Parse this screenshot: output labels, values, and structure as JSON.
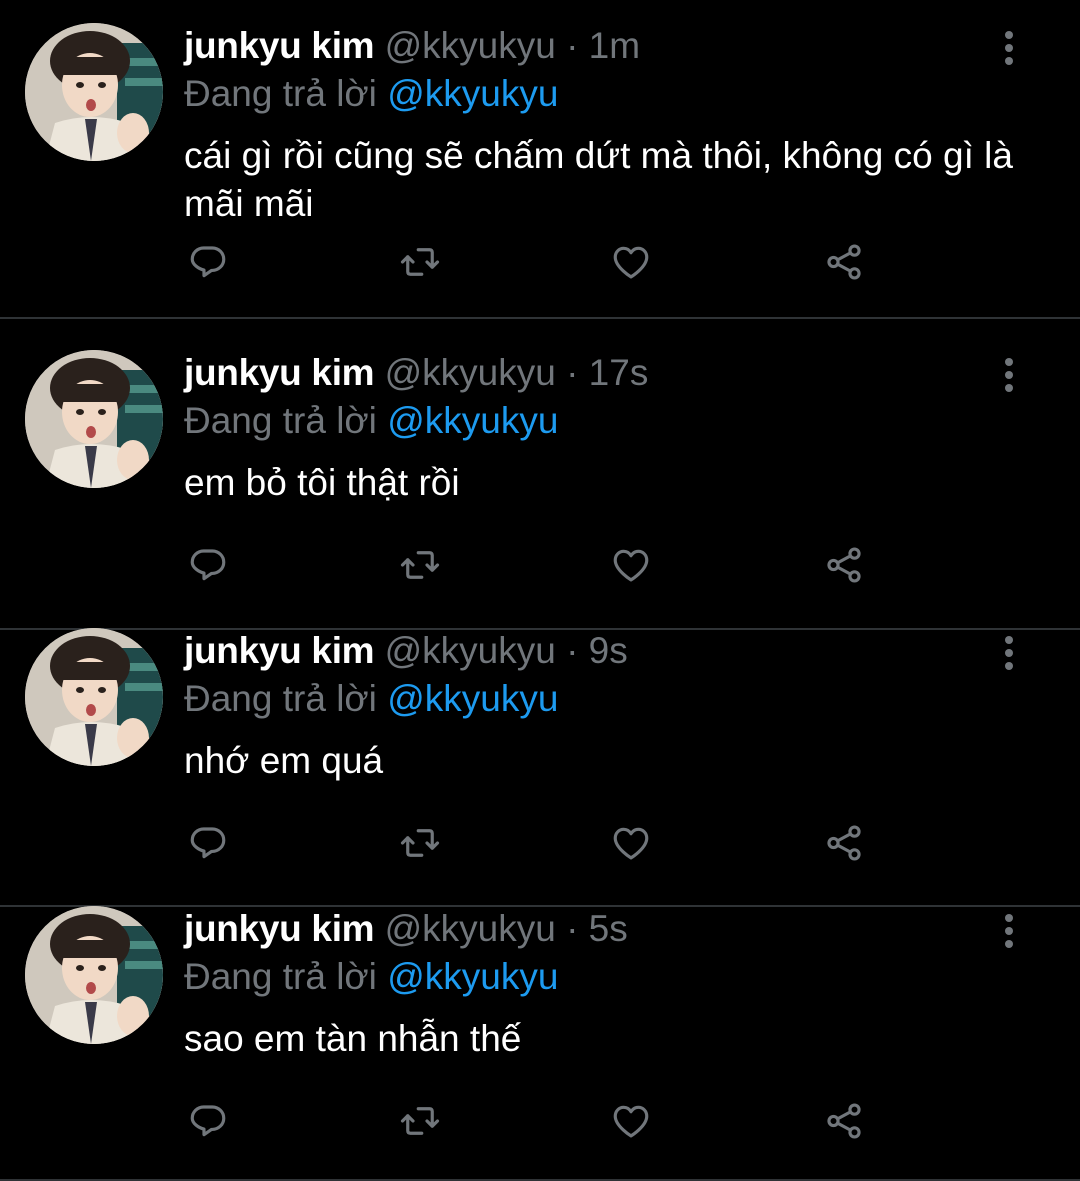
{
  "colors": {
    "background": "#000000",
    "divider": "#2f3336",
    "secondary_text": "#71767b",
    "mention": "#1d9bf0",
    "primary_text": "#ffffff"
  },
  "tweets": [
    {
      "display_name": "junkyu kim",
      "handle": "@kkyukyu",
      "separator": "·",
      "time": "1m",
      "reply_prefix": "Đang trả lời",
      "reply_mention": "@kkyukyu",
      "text": "cái gì rồi cũng sẽ chấm dứt mà thôi, không có gì là mãi mãi",
      "icons": [
        "reply-icon",
        "retweet-icon",
        "like-icon",
        "share-icon",
        "more-icon"
      ]
    },
    {
      "display_name": "junkyu kim",
      "handle": "@kkyukyu",
      "separator": "·",
      "time": "17s",
      "reply_prefix": "Đang trả lời",
      "reply_mention": "@kkyukyu",
      "text": "em bỏ tôi thật rồi",
      "icons": [
        "reply-icon",
        "retweet-icon",
        "like-icon",
        "share-icon",
        "more-icon"
      ]
    },
    {
      "display_name": "junkyu kim",
      "handle": "@kkyukyu",
      "separator": "·",
      "time": "9s",
      "reply_prefix": "Đang trả lời",
      "reply_mention": "@kkyukyu",
      "text": "nhớ em quá",
      "icons": [
        "reply-icon",
        "retweet-icon",
        "like-icon",
        "share-icon",
        "more-icon"
      ]
    },
    {
      "display_name": "junkyu kim",
      "handle": "@kkyukyu",
      "separator": "·",
      "time": "5s",
      "reply_prefix": "Đang trả lời",
      "reply_mention": "@kkyukyu",
      "text": "sao em tàn nhẫn thế",
      "icons": [
        "reply-icon",
        "retweet-icon",
        "like-icon",
        "share-icon",
        "more-icon"
      ]
    }
  ]
}
